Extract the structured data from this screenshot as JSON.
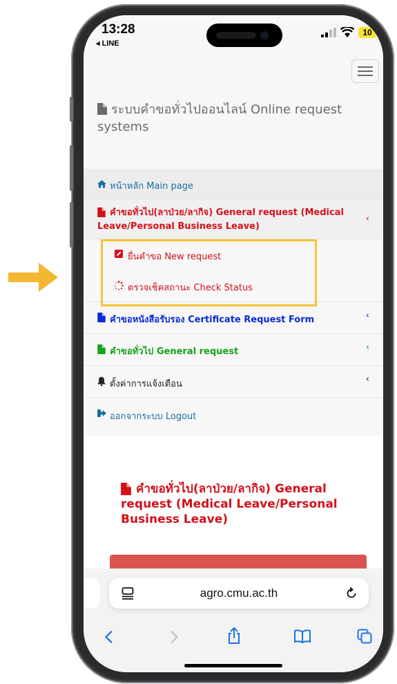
{
  "status_bar": {
    "time": "13:28",
    "back_app": "◂ LINE",
    "battery": "10"
  },
  "site": {
    "title": "ระบบคำขอทั่วไปออนไลน์ Online request systems"
  },
  "nav": {
    "main_page": "หน้าหลัก Main page",
    "general_request_leave": "คำขอทั่วไป(ลาป่วย/ลากิจ) General request (Medical Leave/Personal Business Leave)",
    "new_request": "ยื่นคำขอ New request",
    "check_status": "ตรวจเช็คสถานะ Check Status",
    "certificate_request": "คำขอหนังสือรับรอง Certificate Request Form",
    "general_request": "คำขอทั่วไป General request",
    "notification_settings": "ตั้งค่าการแจ้งเตือน",
    "logout": "ออกจากระบบ Logout",
    "chevron": "‹"
  },
  "content": {
    "title": "คำขอทั่วไป(ลาป่วย/ลากิจ) General request (Medical Leave/Personal Business Leave)"
  },
  "browser": {
    "url": "agro.cmu.ac.th"
  },
  "colors": {
    "red": "#d5101a",
    "blue": "#0a2bd6",
    "green": "#15a318",
    "teal": "#1a6fa0",
    "highlight": "#f4c43a",
    "arrow": "#f4b731"
  },
  "icons": [
    "arrow-right-icon",
    "menu-icon",
    "document-icon",
    "home-icon",
    "edit-icon",
    "spinner-icon",
    "bell-icon",
    "logout-icon",
    "reader-icon",
    "reload-icon",
    "back-icon",
    "forward-icon",
    "share-icon",
    "bookmarks-icon",
    "tabs-icon"
  ]
}
